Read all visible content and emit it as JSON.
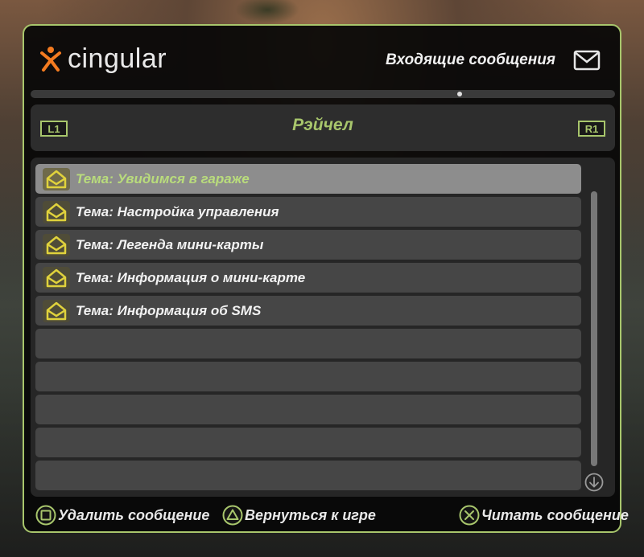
{
  "app": {
    "logo_text": "cingular",
    "title": "Входящие сообщения",
    "accent_color": "#a8c66c",
    "logo_color": "#f47b20"
  },
  "contact_bar": {
    "left_button": "L1",
    "right_button": "R1",
    "contact_name": "Рэйчел"
  },
  "messages": [
    {
      "subject": "Тема: Увидимся в гараже",
      "selected": true,
      "icon": "envelope-open-icon"
    },
    {
      "subject": "Тема: Настройка управления",
      "selected": false,
      "icon": "envelope-open-icon"
    },
    {
      "subject": "Тема: Легенда мини-карты",
      "selected": false,
      "icon": "envelope-open-icon"
    },
    {
      "subject": "Тема: Информация о мини-карте",
      "selected": false,
      "icon": "envelope-open-icon"
    },
    {
      "subject": "Тема: Информация об SMS",
      "selected": false,
      "icon": "envelope-open-icon"
    }
  ],
  "empty_rows": 5,
  "footer": {
    "delete_label": "Удалить сообщение",
    "back_label": "Вернуться к игре",
    "read_label": "Читать сообщение",
    "delete_icon": "square-button-icon",
    "back_icon": "triangle-button-icon",
    "read_icon": "cross-button-icon"
  }
}
